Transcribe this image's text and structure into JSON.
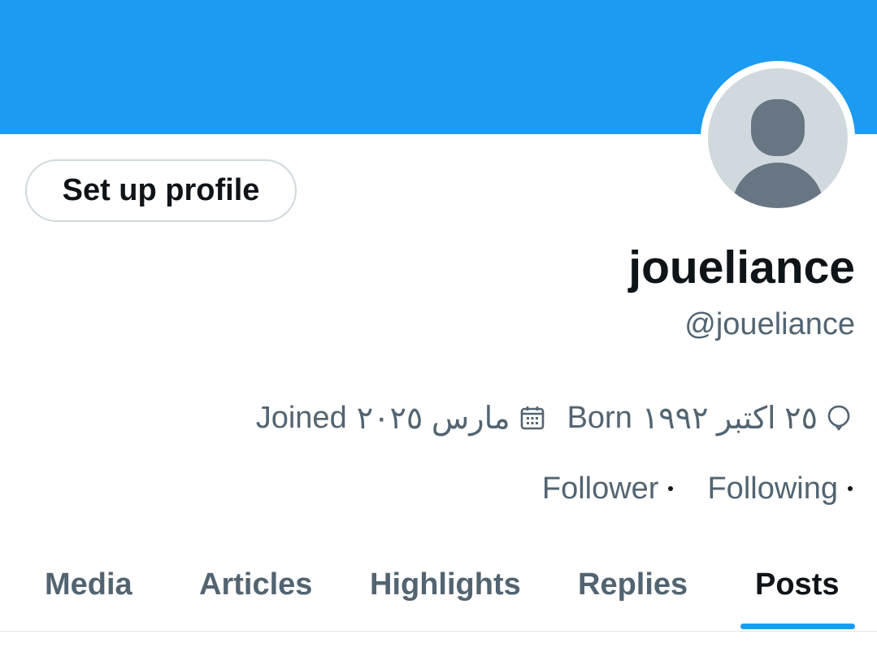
{
  "colors": {
    "banner": "#1d9bf0",
    "text_primary": "#0f1419",
    "text_secondary": "#536471",
    "accent": "#1d9bf0",
    "avatar_bg": "#cfd9de",
    "avatar_figure": "#687684"
  },
  "header": {
    "setup_button_label": "Set up profile",
    "avatar_icon": "default-avatar-icon"
  },
  "profile": {
    "display_name": "joueliance",
    "handle": "@joueliance"
  },
  "meta": {
    "joined_label": "Joined",
    "joined_date": "مارس ٢٠٢٥",
    "joined_icon": "calendar-icon",
    "born_label": "Born",
    "born_date": "٢٥ اكتبر ١٩٩٢",
    "born_icon": "balloon-icon"
  },
  "follow": {
    "follower_label": "Follower",
    "following_label": "Following"
  },
  "tabs": [
    {
      "label": "Media",
      "active": false
    },
    {
      "label": "Articles",
      "active": false
    },
    {
      "label": "Highlights",
      "active": false
    },
    {
      "label": "Replies",
      "active": false
    },
    {
      "label": "Posts",
      "active": true
    }
  ]
}
